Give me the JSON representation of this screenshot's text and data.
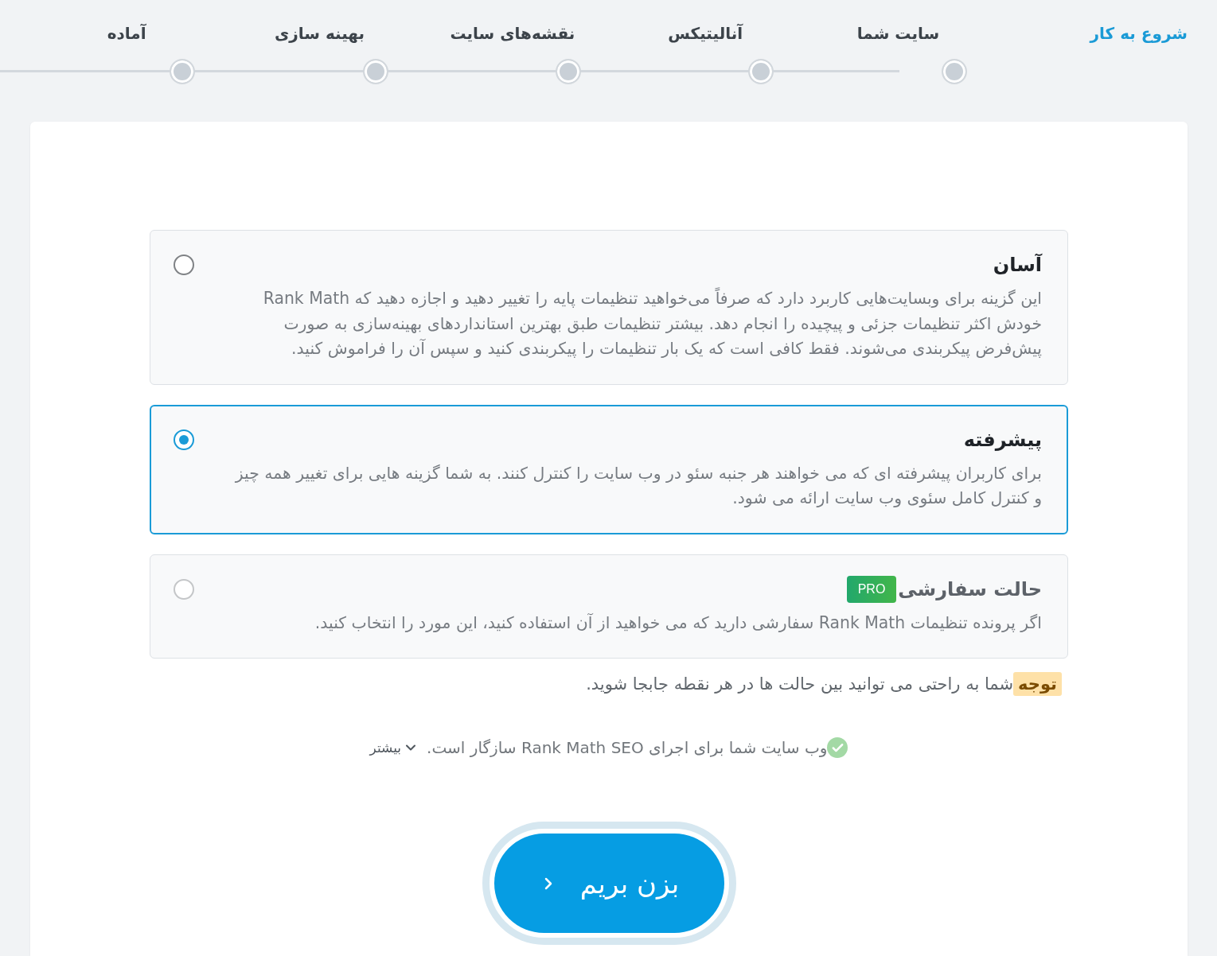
{
  "steps": [
    {
      "label": "شروع به کار",
      "selected": true
    },
    {
      "label": "سایت شما",
      "selected": false
    },
    {
      "label": "آنالیتیکس",
      "selected": false
    },
    {
      "label": "نقشه‌های سایت",
      "selected": false
    },
    {
      "label": "بهینه سازی",
      "selected": false
    },
    {
      "label": "آماده",
      "selected": false
    }
  ],
  "options": [
    {
      "title": "آسان",
      "description": "این گزینه برای وبسایت‌هایی کاربرد دارد که صرفاً می‌خواهید تنظیمات پایه را تغییر دهید و اجازه دهید که Rank Math خودش اکثر تنظیمات جزئی و پیچیده را انجام دهد. بیشتر تنظیمات طبق بهترین استانداردهای بهینه‌سازی به صورت پیش‌فرض پیکربندی می‌شوند. فقط کافی است که یک بار تنظیمات را پیکربندی کنید و سپس آن را فراموش کنید.",
      "selected": false,
      "disabled": false
    },
    {
      "title": "پیشرفته",
      "description": "برای کاربران پیشرفته ای که می خواهند هر جنبه سئو در وب سایت را کنترل کنند. به شما گزینه هایی برای تغییر همه چیز و کنترل کامل سئوی وب سایت ارائه می شود.",
      "selected": true,
      "disabled": false
    },
    {
      "title": "حالت سفارشی",
      "badge": "PRO",
      "description": "اگر پرونده تنظیمات Rank Math سفارشی دارید که می خواهید از آن استفاده کنید، این مورد را انتخاب کنید.",
      "selected": false,
      "disabled": true
    }
  ],
  "note": {
    "label": "توجه",
    "text": "شما به راحتی می توانید بین حالت ها در هر نقطه جابجا شوید."
  },
  "compatibility": {
    "text": "وب سایت شما برای اجرای Rank Math SEO سازگار است.",
    "link": "بیشتر"
  },
  "continue_button": {
    "label": "بزن بریم"
  }
}
